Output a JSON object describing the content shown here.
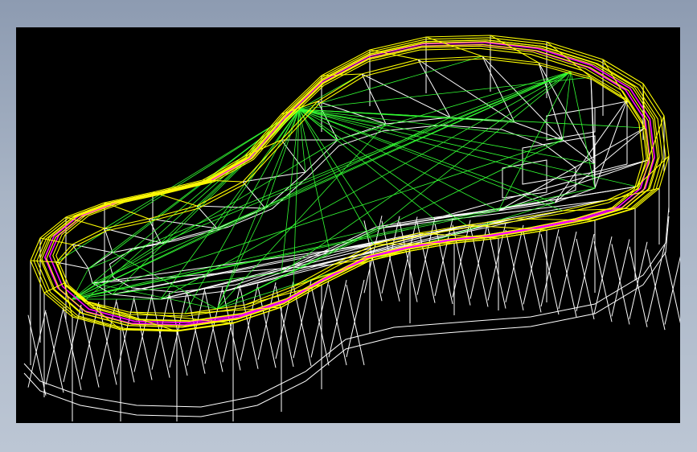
{
  "app": {
    "background_gradient": [
      "#8d9bb1",
      "#bcc6d4"
    ]
  },
  "viewport": {
    "background_color": "#000000",
    "render_mode": "wireframe",
    "colors": {
      "body_edges": "#ffffff",
      "rim_edges": "#ffff00",
      "inner_rim_edges": "#ff00ff",
      "floor_triangulation": "#33ff33"
    }
  }
}
